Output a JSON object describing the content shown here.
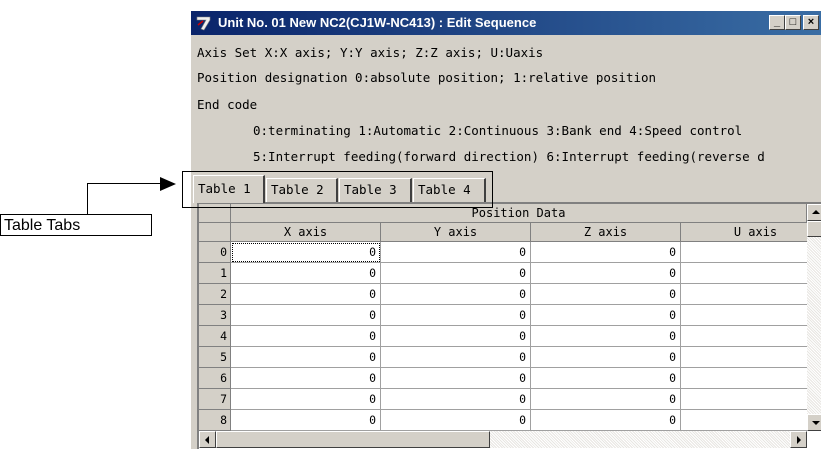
{
  "callout": {
    "label": "Table Tabs"
  },
  "window": {
    "title": "Unit No. 01 New NC2(CJ1W-NC413) : Edit Sequence",
    "buttons": [
      "_",
      "□",
      "×"
    ]
  },
  "info": {
    "axis_set": "Axis Set X:X axis; Y:Y axis; Z:Z axis; U:Uaxis",
    "position_designation": "Position designation 0:absolute position; 1:relative position",
    "end_code_heading": "End code",
    "end_code_line1": "0:terminating 1:Automatic 2:Continuous 3:Bank end 4:Speed control",
    "end_code_line2": "5:Interrupt feeding(forward direction) 6:Interrupt feeding(reverse d"
  },
  "tabs": [
    {
      "label": "Table 1",
      "active": true
    },
    {
      "label": "Table 2",
      "active": false
    },
    {
      "label": "Table 3",
      "active": false
    },
    {
      "label": "Table 4",
      "active": false
    }
  ],
  "grid": {
    "group_header": "Position Data",
    "columns": [
      "X axis",
      "Y axis",
      "Z axis",
      "U axis"
    ],
    "rows": [
      {
        "no": "0",
        "values": [
          "0",
          "0",
          "0",
          ""
        ]
      },
      {
        "no": "1",
        "values": [
          "0",
          "0",
          "0",
          ""
        ]
      },
      {
        "no": "2",
        "values": [
          "0",
          "0",
          "0",
          ""
        ]
      },
      {
        "no": "3",
        "values": [
          "0",
          "0",
          "0",
          ""
        ]
      },
      {
        "no": "4",
        "values": [
          "0",
          "0",
          "0",
          ""
        ]
      },
      {
        "no": "5",
        "values": [
          "0",
          "0",
          "0",
          ""
        ]
      },
      {
        "no": "6",
        "values": [
          "0",
          "0",
          "0",
          ""
        ]
      },
      {
        "no": "7",
        "values": [
          "0",
          "0",
          "0",
          ""
        ]
      },
      {
        "no": "8",
        "values": [
          "0",
          "0",
          "0",
          ""
        ]
      }
    ]
  },
  "colors": {
    "titlebar_start": "#0a246a",
    "titlebar_end": "#3a6ea5",
    "face": "#d4d0c8"
  }
}
